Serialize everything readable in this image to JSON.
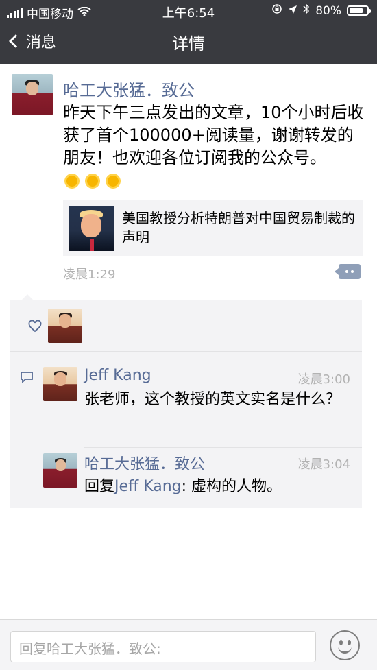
{
  "status_bar": {
    "carrier": "中国移动",
    "time": "上午6:54",
    "battery": "80%",
    "battery_level": 0.8
  },
  "nav": {
    "back_label": "消息",
    "title": "详情"
  },
  "post": {
    "author": "哈工大张猛．致公",
    "text": "昨天下午三点发出的文章，10个小时后收获了首个100000+阅读量，谢谢转发的朋友！也欢迎各位订阅我的公众号。",
    "emojis": [
      "sun-icon",
      "sun-icon",
      "sun-icon"
    ],
    "link": {
      "title": "美国教授分析特朗普对中国贸易制裁的声明"
    },
    "time": "凌晨1:29"
  },
  "comments": [
    {
      "name": "Jeff Kang",
      "time": "凌晨3:00",
      "text": "张老师，这个教授的英文实名是什么？"
    },
    {
      "name": "哈工大张猛．致公",
      "time": "凌晨3:04",
      "reply_prefix": "回复",
      "reply_to": "Jeff Kang",
      "reply_colon": ": ",
      "text": "虚构的人物。"
    }
  ],
  "input": {
    "placeholder": "回复哈工大张猛．致公:"
  },
  "colors": {
    "header_bg": "#393a3f",
    "name_blue": "#576b95",
    "panel_bg": "#f3f3f5"
  }
}
